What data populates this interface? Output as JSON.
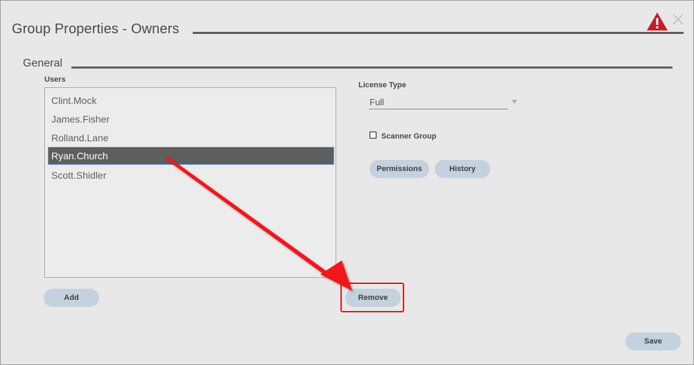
{
  "dialog": {
    "title": "Group Properties - Owners",
    "warning_icon": "warning-triangle-icon",
    "close_icon": "close-icon"
  },
  "section": {
    "title": "General"
  },
  "users": {
    "label": "Users",
    "items": [
      "Clint.Mock",
      "James.Fisher",
      "Rolland.Lane",
      "Ryan.Church",
      "Scott.Shidler"
    ],
    "selected": "Ryan.Church"
  },
  "license": {
    "label": "License Type",
    "value": "Full"
  },
  "scanner_group": {
    "label": "Scanner Group",
    "checked": false
  },
  "buttons": {
    "permissions": "Permissions",
    "history": "History",
    "add": "Add",
    "remove": "Remove",
    "save": "Save"
  },
  "colors": {
    "accent_button": "#c4d1de",
    "selected_row": "#5e5e5e",
    "annotation": "#e5161d",
    "warning": "#c0202a"
  }
}
